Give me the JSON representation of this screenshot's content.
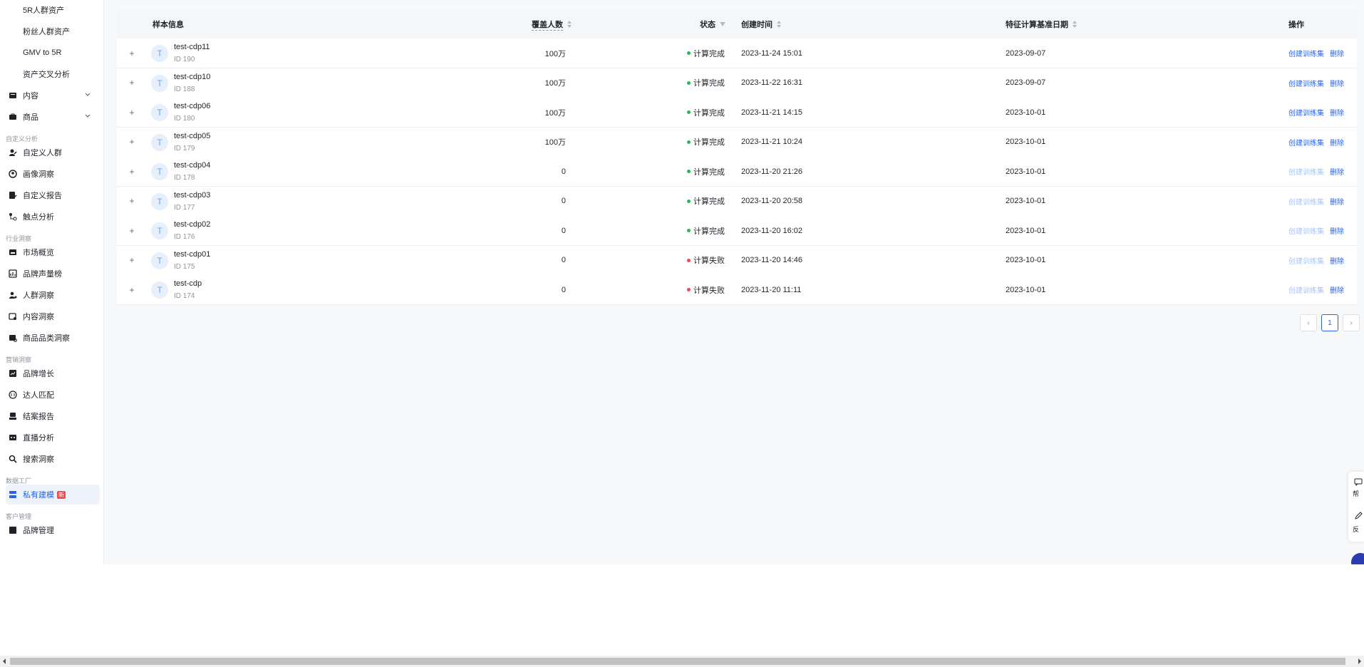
{
  "sidebar": {
    "items_top": [
      {
        "label": "5R人群资产",
        "icon": "none"
      },
      {
        "label": "粉丝人群资产",
        "icon": "none"
      },
      {
        "label": "GMV to 5R",
        "icon": "none"
      },
      {
        "label": "资产交叉分析",
        "icon": "none"
      }
    ],
    "collapsible": [
      {
        "label": "内容",
        "icon": "content-icon"
      },
      {
        "label": "商品",
        "icon": "product-icon"
      }
    ],
    "groups": [
      {
        "title": "自定义分析",
        "items": [
          {
            "label": "自定义人群",
            "icon": "user-edit-icon"
          },
          {
            "label": "画像洞察",
            "icon": "profile-icon"
          },
          {
            "label": "自定义报告",
            "icon": "report-edit-icon"
          },
          {
            "label": "触点分析",
            "icon": "touchpoint-icon"
          }
        ]
      },
      {
        "title": "行业洞察",
        "items": [
          {
            "label": "市场概览",
            "icon": "market-icon"
          },
          {
            "label": "品牌声量榜",
            "icon": "rank-icon"
          },
          {
            "label": "人群洞察",
            "icon": "crowd-icon"
          },
          {
            "label": "内容洞察",
            "icon": "content-insight-icon"
          },
          {
            "label": "商品品类洞察",
            "icon": "category-icon"
          }
        ]
      },
      {
        "title": "营销洞察",
        "items": [
          {
            "label": "品牌增长",
            "icon": "growth-icon"
          },
          {
            "label": "达人匹配",
            "icon": "match-icon"
          },
          {
            "label": "结案报告",
            "icon": "closing-report-icon"
          },
          {
            "label": "直播分析",
            "icon": "live-icon"
          },
          {
            "label": "搜索洞察",
            "icon": "search-icon"
          }
        ]
      },
      {
        "title": "数据工厂",
        "items": [
          {
            "label": "私有建模",
            "icon": "modeling-icon",
            "active": true,
            "badge": "新"
          }
        ]
      },
      {
        "title": "客户管理",
        "items": [
          {
            "label": "品牌管理",
            "icon": "brand-manage-icon"
          }
        ]
      }
    ]
  },
  "table": {
    "headers": {
      "sample": "样本信息",
      "cover": "覆盖人数",
      "status": "状态",
      "created": "创建时间",
      "basedate": "特征计算基准日期",
      "ops": "操作"
    },
    "rows": [
      {
        "expand": "+",
        "avatar": "T",
        "name": "test-cdp11",
        "id": "ID 190",
        "cover": "100万",
        "status": "计算完成",
        "status_color": "#2fb35a",
        "created": "2023-11-24 15:01",
        "basedate": "2023-09-07",
        "train": "创建训练集",
        "train_enabled": true,
        "del": "删除"
      },
      {
        "expand": "+",
        "avatar": "T",
        "name": "test-cdp10",
        "id": "ID 188",
        "cover": "100万",
        "status": "计算完成",
        "status_color": "#2fb35a",
        "created": "2023-11-22 16:31",
        "basedate": "2023-09-07",
        "train": "创建训练集",
        "train_enabled": true,
        "del": "删除"
      },
      {
        "expand": "+",
        "avatar": "T",
        "name": "test-cdp06",
        "id": "ID 180",
        "cover": "100万",
        "status": "计算完成",
        "status_color": "#2fb35a",
        "created": "2023-11-21 14:15",
        "basedate": "2023-10-01",
        "train": "创建训练集",
        "train_enabled": true,
        "del": "删除"
      },
      {
        "expand": "+",
        "avatar": "T",
        "name": "test-cdp05",
        "id": "ID 179",
        "cover": "100万",
        "status": "计算完成",
        "status_color": "#2fb35a",
        "created": "2023-11-21 10:24",
        "basedate": "2023-10-01",
        "train": "创建训练集",
        "train_enabled": true,
        "del": "删除"
      },
      {
        "expand": "+",
        "avatar": "T",
        "name": "test-cdp04",
        "id": "ID 178",
        "cover": "0",
        "status": "计算完成",
        "status_color": "#2fb35a",
        "created": "2023-11-20 21:26",
        "basedate": "2023-10-01",
        "train": "创建训练集",
        "train_enabled": false,
        "del": "删除"
      },
      {
        "expand": "+",
        "avatar": "T",
        "name": "test-cdp03",
        "id": "ID 177",
        "cover": "0",
        "status": "计算完成",
        "status_color": "#2fb35a",
        "created": "2023-11-20 20:58",
        "basedate": "2023-10-01",
        "train": "创建训练集",
        "train_enabled": false,
        "del": "删除"
      },
      {
        "expand": "+",
        "avatar": "T",
        "name": "test-cdp02",
        "id": "ID 176",
        "cover": "0",
        "status": "计算完成",
        "status_color": "#2fb35a",
        "created": "2023-11-20 16:02",
        "basedate": "2023-10-01",
        "train": "创建训练集",
        "train_enabled": false,
        "del": "删除"
      },
      {
        "expand": "+",
        "avatar": "T",
        "name": "test-cdp01",
        "id": "ID 175",
        "cover": "0",
        "status": "计算失败",
        "status_color": "#f5474f",
        "created": "2023-11-20 14:46",
        "basedate": "2023-10-01",
        "train": "创建训练集",
        "train_enabled": false,
        "del": "删除"
      },
      {
        "expand": "+",
        "avatar": "T",
        "name": "test-cdp",
        "id": "ID 174",
        "cover": "0",
        "status": "计算失败",
        "status_color": "#f5474f",
        "created": "2023-11-20 11:11",
        "basedate": "2023-10-01",
        "train": "创建训练集",
        "train_enabled": false,
        "del": "删除"
      }
    ]
  },
  "pagination": {
    "prev": "‹",
    "current": "1",
    "next": "›"
  },
  "float_panel": {
    "help": "帮",
    "feedback": "反"
  },
  "colors": {
    "accent": "#2a63e8",
    "success": "#2fb35a",
    "error": "#f5474f"
  }
}
